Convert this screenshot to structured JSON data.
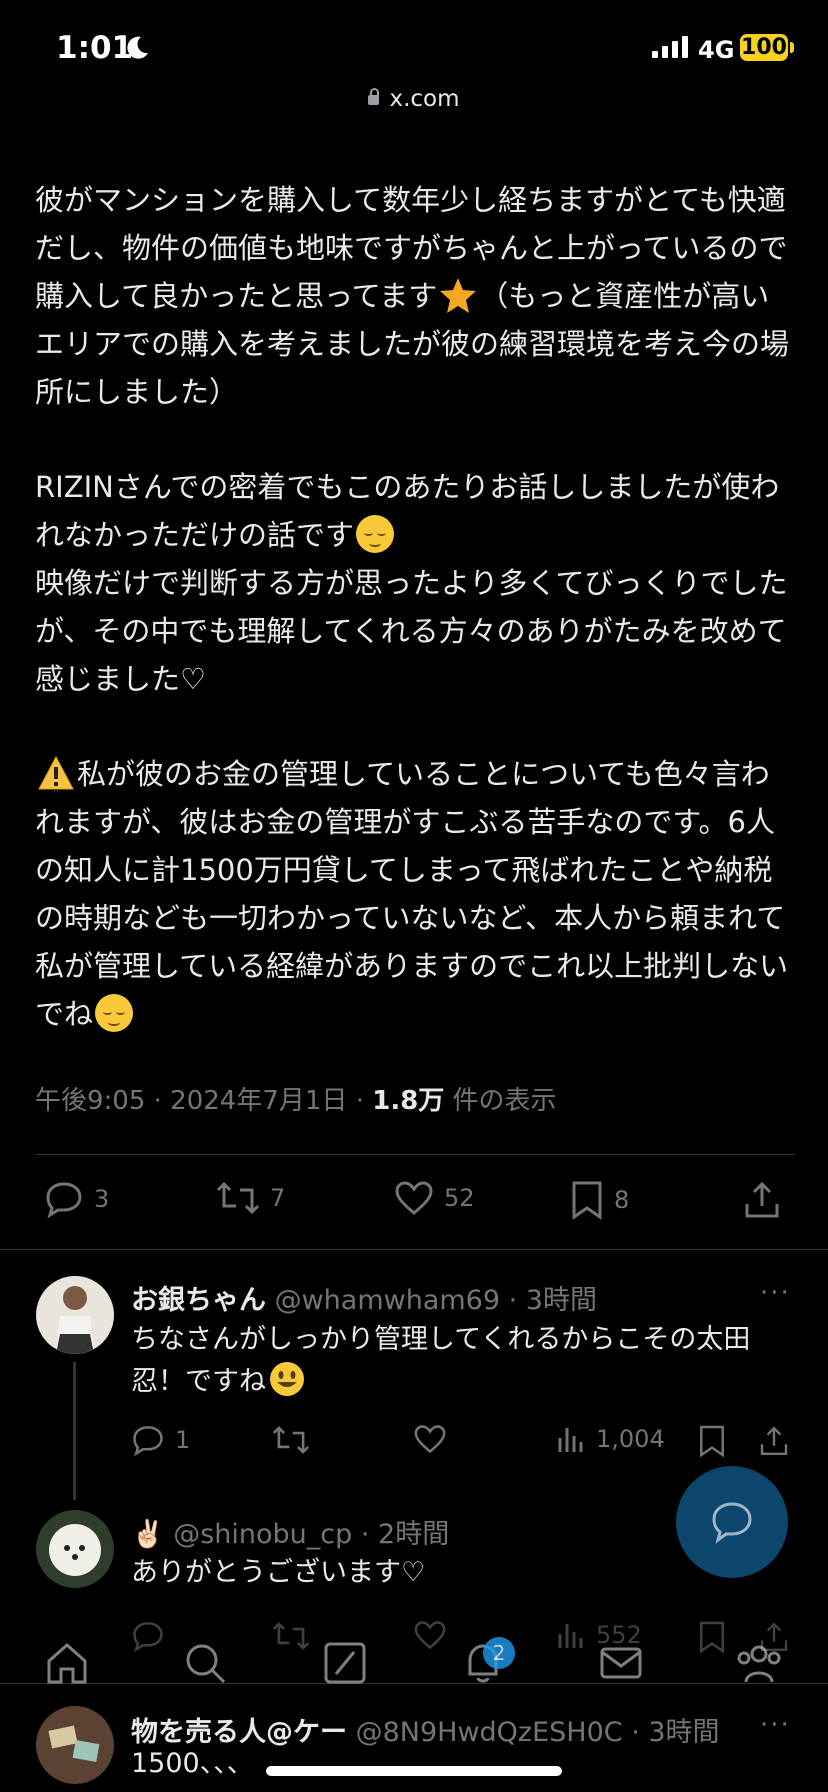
{
  "status": {
    "time": "1:01",
    "network": "4G",
    "battery": "100"
  },
  "browser": {
    "url": "x.com"
  },
  "post": {
    "para1": "彼がマンションを購入して数年少し経ちますがとても快適だし、物件の価値も地味ですがちゃんと上がっているので購入して良かったと思ってます",
    "para1b": "（もっと資産性が高いエリアでの購入を考えましたが彼の練習環境を考え今の場所にしました）",
    "para2": "RIZINさんでの密着でもこのあたりお話ししましたが使われなかっただけの話です",
    "para3": "映像だけで判断する方が思ったより多くてびっくりでしたが、その中でも理解してくれる方々のありがたみを改めて感じました♡",
    "para4": "私が彼のお金の管理していることについても色々言われますが、彼はお金の管理がすこぶる苦手なのです。6人の知人に計1500万円貸してしまって飛ばれたことや納税の時期なども一切わかっていないなど、本人から頼まれて私が管理している経緯がありますのでこれ以上批判しないでね",
    "meta_time": "午後9:05 · 2024年7月1日 · ",
    "views": "1.8万",
    "views_label": " 件の表示"
  },
  "actions": {
    "replies": "3",
    "reposts": "7",
    "likes": "52",
    "bookmarks": "8"
  },
  "replies": [
    {
      "name": "お銀ちゃん",
      "handle": "@whamwham69 · 3時間",
      "text": "ちなさんがしっかり管理してくれるからこその太田忍！ですね",
      "reply_count": "1",
      "views": "1,004"
    },
    {
      "name": "✌🏻",
      "handle": "@shinobu_cp · 2時間",
      "text": "ありがとうございます♡",
      "views": "552"
    },
    {
      "name": "物を売る人@ケー",
      "handle": "@8N9HwdQzESH0C · 3時間",
      "text": "1500、、、"
    }
  ],
  "more_label": "···",
  "tabs": {
    "notifications_badge": "2"
  },
  "icons": [
    "moon-icon",
    "signal-icon",
    "lock-icon",
    "star-icon",
    "relieved-face-icon",
    "warning-icon",
    "smiley-icon",
    "reply-icon",
    "repost-icon",
    "like-icon",
    "bookmark-icon",
    "share-icon",
    "views-icon",
    "compose-icon",
    "home-icon",
    "search-icon",
    "grok-icon",
    "bell-icon",
    "mail-icon",
    "communities-icon"
  ]
}
